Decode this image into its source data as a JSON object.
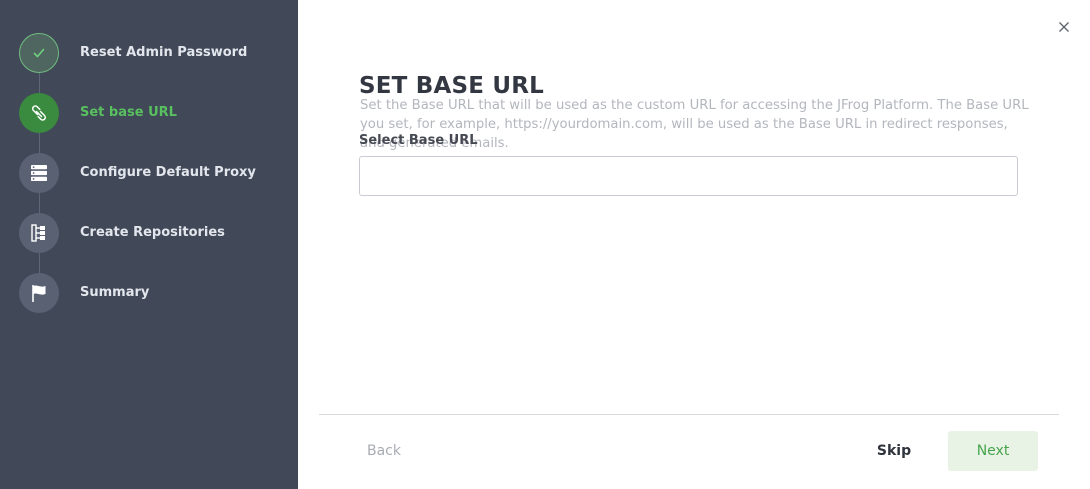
{
  "sidebar": {
    "steps": [
      {
        "label": "Reset Admin Password",
        "icon": "check-icon",
        "state": "completed"
      },
      {
        "label": "Set base URL",
        "icon": "link-icon",
        "state": "active"
      },
      {
        "label": "Configure Default Proxy",
        "icon": "server-icon",
        "state": "pending"
      },
      {
        "label": "Create Repositories",
        "icon": "repository-tree-icon",
        "state": "pending"
      },
      {
        "label": "Summary",
        "icon": "flag-icon",
        "state": "pending"
      }
    ]
  },
  "main": {
    "title": "SET BASE URL",
    "description": "Set the Base URL that will be used as the custom URL for accessing the JFrog Platform. The Base URL you set, for example, https://yourdomain.com, will be used as the Base URL in redirect responses, and generated emails.",
    "field_label": "Select Base URL",
    "base_url_value": "",
    "close_icon": "close-icon"
  },
  "footer": {
    "back_label": "Back",
    "skip_label": "Skip",
    "next_label": "Next"
  },
  "colors": {
    "sidebar_bg": "#414858",
    "active_green": "#58c05e",
    "next_button_bg": "#e8f3e6"
  }
}
